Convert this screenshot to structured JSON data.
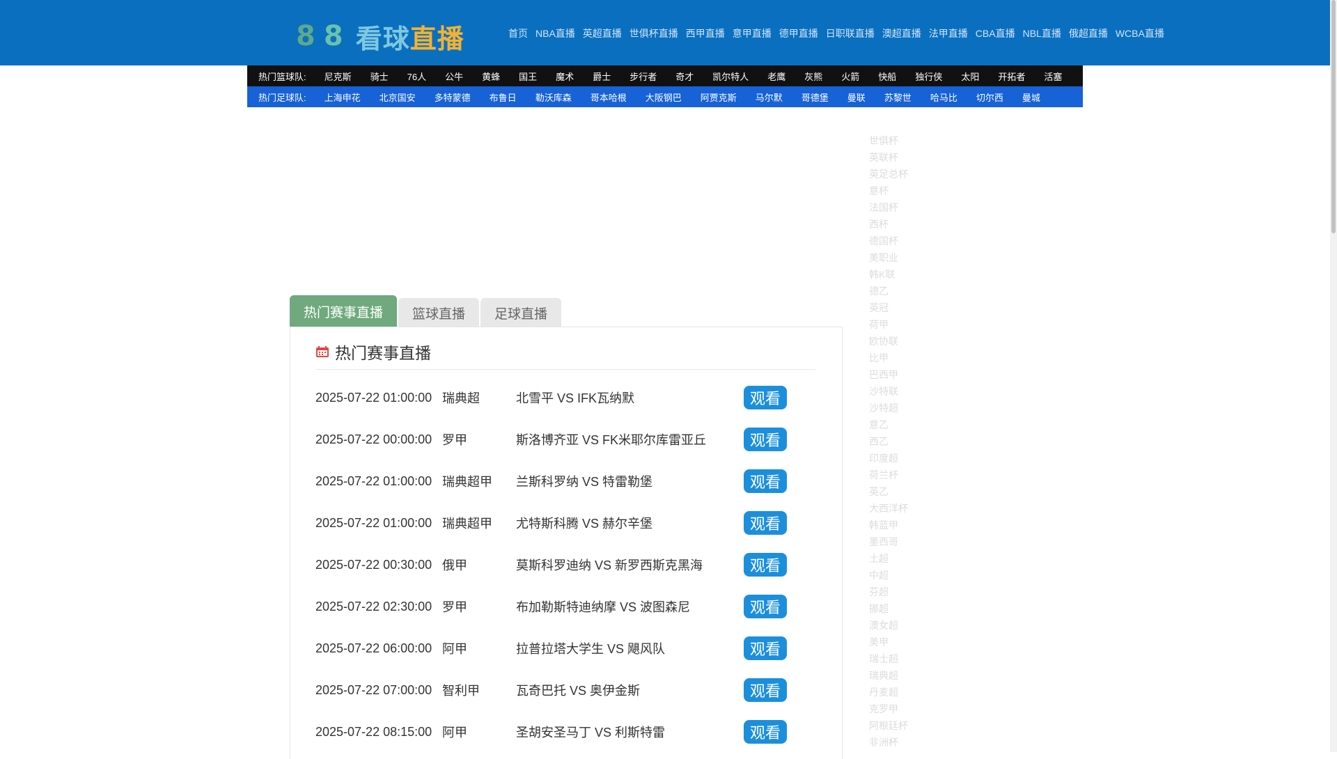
{
  "header": {
    "logo_digits": [
      "8",
      "8"
    ],
    "logo_text_1": "看球",
    "logo_text_2": "直播",
    "nav": [
      "首页",
      "NBA直播",
      "英超直播",
      "世俱杯直播",
      "西甲直播",
      "意甲直播",
      "德甲直播",
      "日职联直播",
      "澳超直播",
      "法甲直播",
      "CBA直播",
      "NBL直播",
      "俄超直播",
      "WCBA直播"
    ]
  },
  "basketball_bar": {
    "label": "热门篮球队:",
    "teams": [
      "尼克斯",
      "骑士",
      "76人",
      "公牛",
      "黄蜂",
      "国王",
      "魔术",
      "爵士",
      "步行者",
      "奇才",
      "凯尔特人",
      "老鹰",
      "灰熊",
      "火箭",
      "快船",
      "独行侠",
      "太阳",
      "开拓者",
      "活塞"
    ]
  },
  "football_bar": {
    "label": "热门足球队:",
    "teams": [
      "上海申花",
      "北京国安",
      "多特蒙德",
      "布鲁日",
      "勒沃库森",
      "哥本哈根",
      "大阪钢巴",
      "阿贾克斯",
      "马尔默",
      "哥德堡",
      "曼联",
      "苏黎世",
      "哈马比",
      "切尔西",
      "曼城"
    ]
  },
  "tabs": [
    "热门赛事直播",
    "篮球直播",
    "足球直播"
  ],
  "panel": {
    "title": "热门赛事直播",
    "watch_label": "观看",
    "rows": [
      {
        "time": "2025-07-22 01:00:00",
        "league": "瑞典超",
        "match": "北雪平 VS IFK瓦纳默"
      },
      {
        "time": "2025-07-22 00:00:00",
        "league": "罗甲",
        "match": "斯洛博齐亚 VS FK米耶尔库雷亚丘"
      },
      {
        "time": "2025-07-22 01:00:00",
        "league": "瑞典超甲",
        "match": "兰斯科罗纳 VS 特雷勒堡"
      },
      {
        "time": "2025-07-22 01:00:00",
        "league": "瑞典超甲",
        "match": "尤特斯科腾 VS 赫尔辛堡"
      },
      {
        "time": "2025-07-22 00:30:00",
        "league": "俄甲",
        "match": "莫斯科罗迪纳 VS 新罗西斯克黑海"
      },
      {
        "time": "2025-07-22 02:30:00",
        "league": "罗甲",
        "match": "布加勒斯特迪纳摩 VS 波图森尼"
      },
      {
        "time": "2025-07-22 06:00:00",
        "league": "阿甲",
        "match": "拉普拉塔大学生 VS 飓风队"
      },
      {
        "time": "2025-07-22 07:00:00",
        "league": "智利甲",
        "match": "瓦奇巴托 VS 奥伊金斯"
      },
      {
        "time": "2025-07-22 08:15:00",
        "league": "阿甲",
        "match": "圣胡安圣马丁 VS 利斯特雷"
      }
    ]
  },
  "right_list": [
    "世俱杯",
    "英联杯",
    "英足总杯",
    "意杯",
    "法国杯",
    "西杯",
    "德国杯",
    "美职业",
    "韩K联",
    "德乙",
    "英冠",
    "荷甲",
    "欧协联",
    "比甲",
    "巴西甲",
    "沙特联",
    "沙特超",
    "意乙",
    "西乙",
    "印度超",
    "荷兰杯",
    "英乙",
    "大西洋杯",
    "韩蓝甲",
    "墨西哥",
    "土超",
    "中超",
    "芬超",
    "挪超",
    "澳女超",
    "美甲",
    "瑞士超",
    "瑞典超",
    "丹麦超",
    "克罗甲",
    "阿根廷杯",
    "非洲杯"
  ],
  "colors": {
    "header_bg": "#0b6fbf",
    "basketball_bar_bg": "#111111",
    "football_bar_bg": "#1662d6",
    "active_tab_bg": "#6fa97d",
    "watch_button_bg": "#1c8fdc"
  }
}
